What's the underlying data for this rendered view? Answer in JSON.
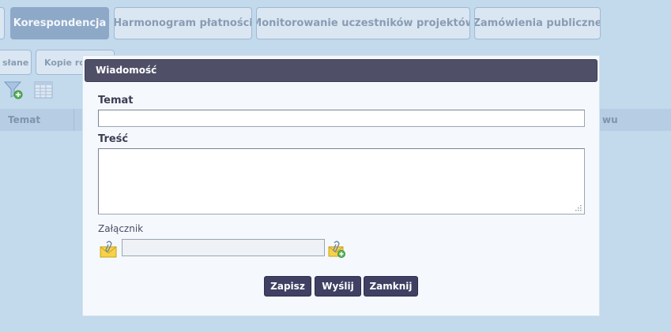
{
  "tabs": [
    {
      "label": "Korespondencja",
      "active": true
    },
    {
      "label": "Harmonogram płatności",
      "active": false
    },
    {
      "label": "Monitorowanie uczestników projektów",
      "active": false
    },
    {
      "label": "Zamówienia publiczne",
      "active": false
    }
  ],
  "subtabs": [
    {
      "label": "słane"
    },
    {
      "label": "Kopie ro"
    }
  ],
  "toolbar": {
    "icons": [
      "filter-add-icon",
      "table-icon"
    ]
  },
  "grid": {
    "columns": [
      "Temat",
      "wu"
    ]
  },
  "dialog": {
    "title": "Wiadomość",
    "subject_label": "Temat",
    "subject_value": "",
    "body_label": "Treść",
    "body_value": "",
    "attachment_label": "Załącznik",
    "attachment_value": "",
    "buttons": {
      "save": "Zapisz",
      "send": "Wyślij",
      "close": "Zamknij"
    }
  },
  "colors": {
    "background": "#c3d9ec",
    "title_bar": "#4f5068",
    "button": "#3f4063",
    "active_tab": "#8ea8c8"
  }
}
